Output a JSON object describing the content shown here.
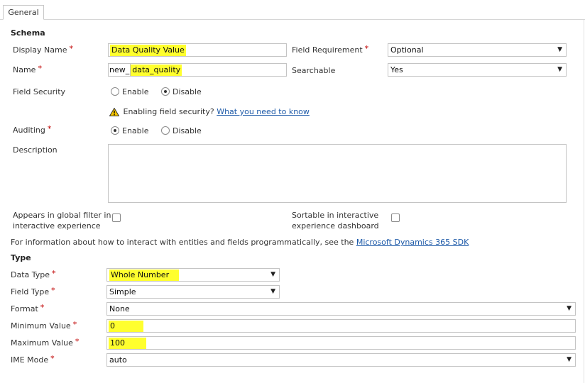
{
  "tabs": [
    {
      "label": "General"
    }
  ],
  "schema": {
    "heading": "Schema",
    "display_name": {
      "label": "Display Name",
      "value": "Data Quality Value"
    },
    "field_requirement": {
      "label": "Field Requirement",
      "value": "Optional"
    },
    "name": {
      "label": "Name",
      "prefix": "new_",
      "value": "data_quality"
    },
    "searchable": {
      "label": "Searchable",
      "value": "Yes"
    },
    "field_security": {
      "label": "Field Security",
      "options": [
        "Enable",
        "Disable"
      ],
      "selected": "Disable"
    },
    "security_warning": {
      "text": "Enabling field security?",
      "link": "What you need to know"
    },
    "auditing": {
      "label": "Auditing",
      "options": [
        "Enable",
        "Disable"
      ],
      "selected": "Enable"
    },
    "description": {
      "label": "Description",
      "value": ""
    },
    "global_filter": {
      "label_line1": "Appears in global filter in",
      "label_line2": "interactive experience",
      "checked": false
    },
    "sortable": {
      "label_line1": "Sortable in interactive",
      "label_line2": "experience dashboard",
      "checked": false
    },
    "info": {
      "text": "For information about how to interact with entities and fields programmatically, see the",
      "link": "Microsoft Dynamics 365 SDK"
    }
  },
  "type": {
    "heading": "Type",
    "data_type": {
      "label": "Data Type",
      "value": "Whole Number"
    },
    "field_type": {
      "label": "Field Type",
      "value": "Simple"
    },
    "format": {
      "label": "Format",
      "value": "None"
    },
    "minimum_value": {
      "label": "Minimum Value",
      "value": "0"
    },
    "maximum_value": {
      "label": "Maximum Value",
      "value": "100"
    },
    "ime_mode": {
      "label": "IME Mode",
      "value": "auto"
    }
  },
  "required_marker": "*",
  "colors": {
    "highlight": "#ffff2e",
    "required": "#c00000",
    "link": "#1e5aa8"
  },
  "icons": {
    "warning": "warning-triangle-icon",
    "dropdown": "chevron-down-icon"
  }
}
